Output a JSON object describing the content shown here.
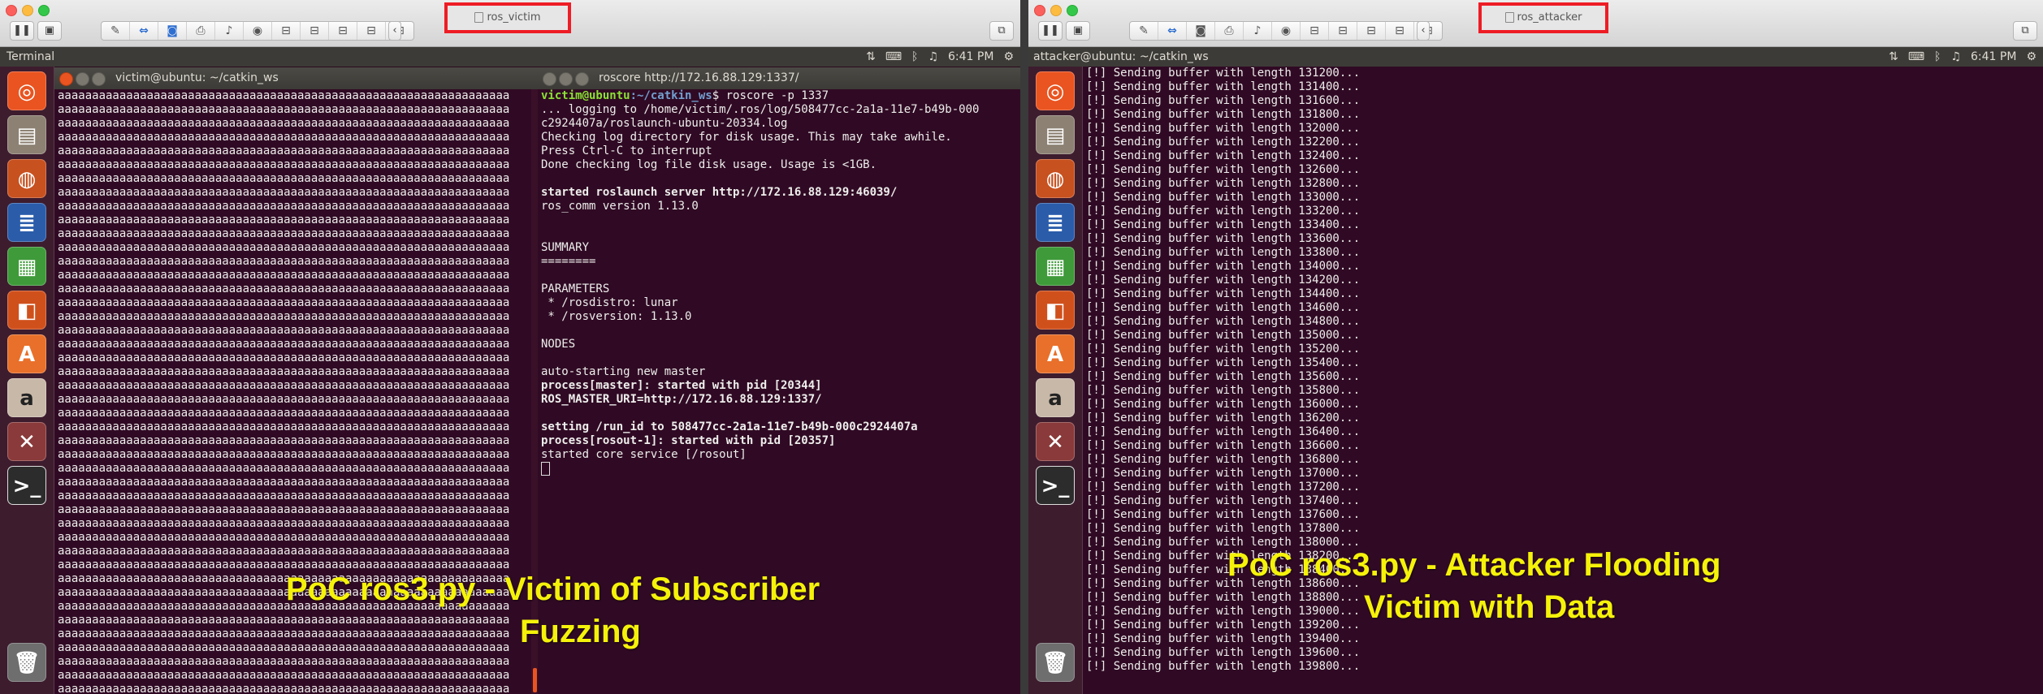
{
  "vm_left": {
    "window_label": "ros_victim",
    "panel_title": "Terminal",
    "clock": "6:41 PM",
    "terminal_victim": {
      "title": "victim@ubuntu: ~/catkin_ws",
      "line": "aaaaaaaaaaaaaaaaaaaaaaaaaaaaaaaaaaaaaaaaaaaaaaaaaaaaaaaaaaaaaaaaaa",
      "line_count": 46
    },
    "terminal_roscore": {
      "title": "roscore http://172.16.88.129:1337/",
      "prompt_user": "victim@ubuntu",
      "prompt_path": ":~/catkin_ws",
      "command": "$ roscore -p 1337",
      "lines": [
        {
          "text": "... logging to /home/victim/.ros/log/508477cc-2a1a-11e7-b49b-000",
          "bold": false
        },
        {
          "text": "c2924407a/roslaunch-ubuntu-20334.log",
          "bold": false
        },
        {
          "text": "Checking log directory for disk usage. This may take awhile.",
          "bold": false
        },
        {
          "text": "Press Ctrl-C to interrupt",
          "bold": false
        },
        {
          "text": "Done checking log file disk usage. Usage is <1GB.",
          "bold": false
        },
        {
          "text": "",
          "bold": false
        },
        {
          "text": "started roslaunch server http://172.16.88.129:46039/",
          "bold": true
        },
        {
          "text": "ros_comm version 1.13.0",
          "bold": false
        },
        {
          "text": "",
          "bold": false
        },
        {
          "text": "",
          "bold": false
        },
        {
          "text": "SUMMARY",
          "bold": false
        },
        {
          "text": "========",
          "bold": false
        },
        {
          "text": "",
          "bold": false
        },
        {
          "text": "PARAMETERS",
          "bold": false
        },
        {
          "text": " * /rosdistro: lunar",
          "bold": false
        },
        {
          "text": " * /rosversion: 1.13.0",
          "bold": false
        },
        {
          "text": "",
          "bold": false
        },
        {
          "text": "NODES",
          "bold": false
        },
        {
          "text": "",
          "bold": false
        },
        {
          "text": "auto-starting new master",
          "bold": false
        },
        {
          "text": "process[master]: started with pid [20344]",
          "bold": true
        },
        {
          "text": "ROS_MASTER_URI=http://172.16.88.129:1337/",
          "bold": true
        },
        {
          "text": "",
          "bold": false
        },
        {
          "text": "setting /run_id to 508477cc-2a1a-11e7-b49b-000c2924407a",
          "bold": true
        },
        {
          "text": "process[rosout-1]: started with pid [20357]",
          "bold": true
        },
        {
          "text": "started core service [/rosout]",
          "bold": false
        }
      ]
    },
    "caption": [
      "PoC ros3.py -   Victim of Subscriber",
      "Fuzzing"
    ]
  },
  "vm_right": {
    "window_label": "ros_attacker",
    "panel_title": "attacker@ubuntu: ~/catkin_ws",
    "clock": "6:41 PM",
    "terminal_attacker": {
      "prefix": "[!] Sending buffer with length ",
      "lengths": [
        "131200",
        "131400",
        "131600",
        "131800",
        "132000",
        "132200",
        "132400",
        "132600",
        "132800",
        "133000",
        "133200",
        "133400",
        "133600",
        "133800",
        "134000",
        "134200",
        "134400",
        "134600",
        "134800",
        "135000",
        "135200",
        "135400",
        "135600",
        "135800",
        "136000",
        "136200",
        "136400",
        "136600",
        "136800",
        "137000",
        "137200",
        "137400",
        "137600",
        "137800",
        "138000",
        "138200",
        "138400",
        "138600",
        "138800",
        "139000",
        "139200",
        "139400",
        "139600",
        "139800"
      ],
      "suffix": "..."
    },
    "caption": [
      "PoC ros3.py -   Attacker Flooding",
      "Victim with Data"
    ]
  },
  "launcher_icons": [
    "dash-icon",
    "files-icon",
    "firefox-icon",
    "writer-icon",
    "calc-icon",
    "impress-icon",
    "software-center-icon",
    "amazon-icon",
    "settings-icon",
    "terminal-icon"
  ],
  "colors": {
    "terminal_bg": "#300a24",
    "accent": "#e95420",
    "caption": "#f5f20a",
    "highlight_box": "#ee1c24"
  }
}
